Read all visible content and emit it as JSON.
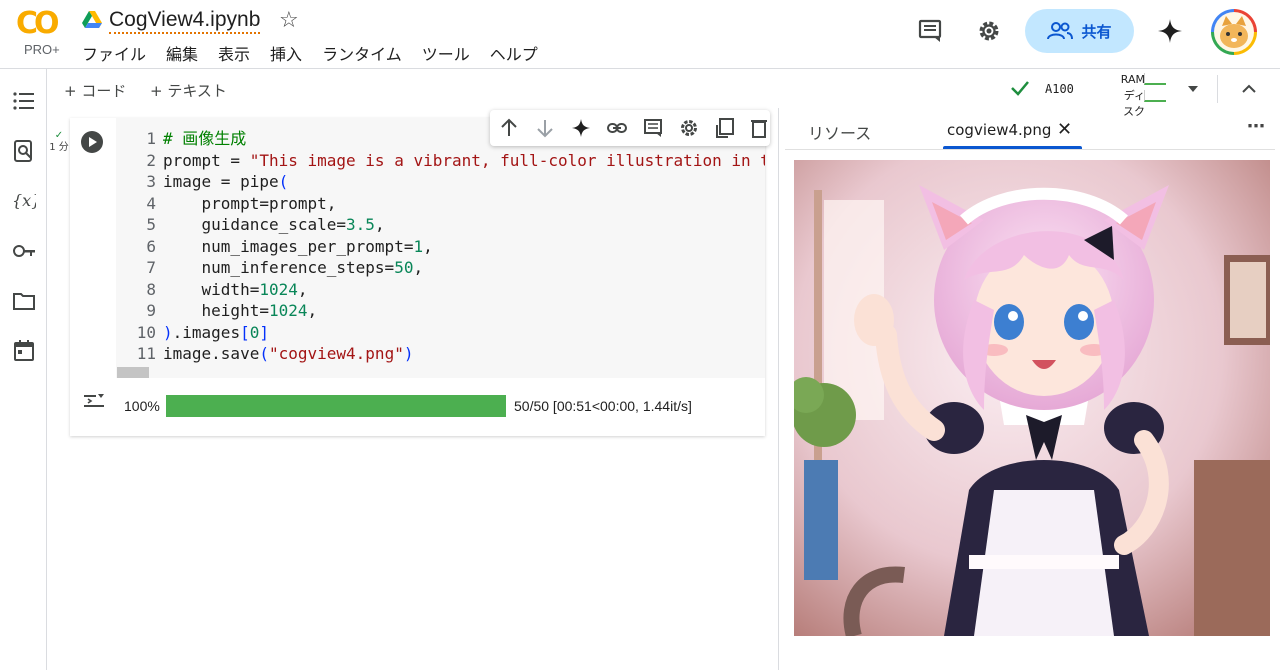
{
  "header": {
    "logo_text": "CO",
    "plan": "PRO+",
    "title": "CogView4.ipynb",
    "menu": [
      "ファイル",
      "編集",
      "表示",
      "挿入",
      "ランタイム",
      "ツール",
      "ヘルプ"
    ],
    "share_label": "共有"
  },
  "toolbar": {
    "add_code": "+ コード",
    "add_text": "+ テキスト",
    "gpu": "A100",
    "ram_label": "RAM",
    "disk_label": "ディスク"
  },
  "cell": {
    "status_time": "1 分",
    "lines": [
      {
        "n": "1",
        "parts": [
          {
            "t": "# 画像生成",
            "c": "c-com"
          }
        ]
      },
      {
        "n": "2",
        "parts": [
          {
            "t": "prompt = ",
            "c": "c-def"
          },
          {
            "t": "\"This image is a vibrant, full-color illustration in t",
            "c": "c-str"
          }
        ]
      },
      {
        "n": "3",
        "parts": [
          {
            "t": "image = pipe",
            "c": "c-def"
          },
          {
            "t": "(",
            "c": "c-brk"
          }
        ]
      },
      {
        "n": "4",
        "parts": [
          {
            "t": "    prompt=prompt,",
            "c": "c-def"
          }
        ]
      },
      {
        "n": "5",
        "parts": [
          {
            "t": "    guidance_scale=",
            "c": "c-def"
          },
          {
            "t": "3.5",
            "c": "c-num"
          },
          {
            "t": ",",
            "c": "c-def"
          }
        ]
      },
      {
        "n": "6",
        "parts": [
          {
            "t": "    num_images_per_prompt=",
            "c": "c-def"
          },
          {
            "t": "1",
            "c": "c-num"
          },
          {
            "t": ",",
            "c": "c-def"
          }
        ]
      },
      {
        "n": "7",
        "parts": [
          {
            "t": "    num_inference_steps=",
            "c": "c-def"
          },
          {
            "t": "50",
            "c": "c-num"
          },
          {
            "t": ",",
            "c": "c-def"
          }
        ]
      },
      {
        "n": "8",
        "parts": [
          {
            "t": "    width=",
            "c": "c-def"
          },
          {
            "t": "1024",
            "c": "c-num"
          },
          {
            "t": ",",
            "c": "c-def"
          }
        ]
      },
      {
        "n": "9",
        "parts": [
          {
            "t": "    height=",
            "c": "c-def"
          },
          {
            "t": "1024",
            "c": "c-num"
          },
          {
            "t": ",",
            "c": "c-def"
          }
        ]
      },
      {
        "n": "10",
        "parts": [
          {
            "t": ")",
            "c": "c-brk"
          },
          {
            "t": ".images",
            "c": "c-def"
          },
          {
            "t": "[",
            "c": "c-brk"
          },
          {
            "t": "0",
            "c": "c-num"
          },
          {
            "t": "]",
            "c": "c-brk"
          }
        ]
      },
      {
        "n": "11",
        "parts": [
          {
            "t": "image.save",
            "c": "c-def"
          },
          {
            "t": "(",
            "c": "c-brk"
          },
          {
            "t": "\"cogview4.png\"",
            "c": "c-str"
          },
          {
            "t": ")",
            "c": "c-brk"
          }
        ]
      }
    ]
  },
  "output": {
    "percent_label": "100%",
    "progress_fraction": 1.0,
    "progress_text": "50/50 [00:51<00:00,  1.44it/s]",
    "bar_color": "#4caf50"
  },
  "right_panel": {
    "tab_resources": "リソース",
    "tab_file": "cogview4.png"
  },
  "colors": {
    "accent": "#0b57d0",
    "share_bg": "#c2e7ff"
  }
}
